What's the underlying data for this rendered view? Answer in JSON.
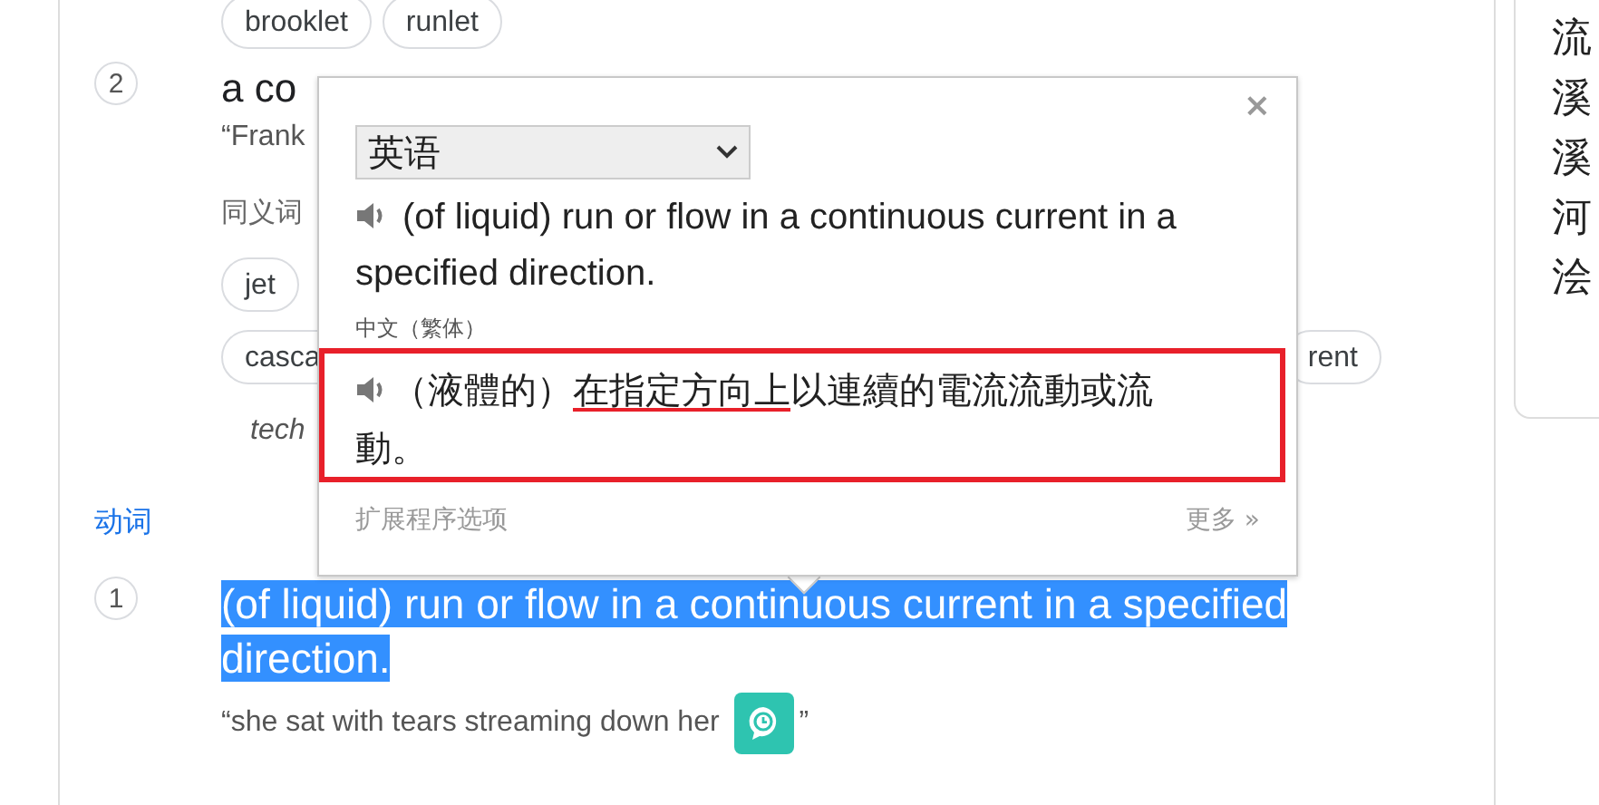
{
  "top_synonyms": [
    "brooklet",
    "runlet"
  ],
  "sense": {
    "number": "2",
    "text": "a co",
    "example": "“Frank",
    "synonyms_label": "同义词",
    "synonym_rows": [
      [
        "jet"
      ],
      [
        "casca",
        "rent"
      ]
    ],
    "note": "tech"
  },
  "part_of_speech": "动词",
  "verb_sense": {
    "number": "1",
    "definition": "(of liquid) run or flow in a continuous current in a specified direction.",
    "selected": true,
    "example_start": "“she sat with tears streaming down her",
    "example_end": "”"
  },
  "side_list": [
    "流",
    "溪",
    "溪",
    "河",
    "浍"
  ],
  "popup": {
    "close": "×",
    "language": "英语",
    "source_text": "(of liquid) run or flow in a continuous current in a specified direction.",
    "target_language": "中文（繁体）",
    "translation_parts": [
      {
        "text": "（液體的）",
        "underlined": false
      },
      {
        "text": "在指定方向上",
        "underlined": true
      },
      {
        "text": "以連續的電流流動或流動。",
        "underlined": false
      }
    ],
    "options_link": "扩展程序选项",
    "more_link": "更多 »"
  }
}
